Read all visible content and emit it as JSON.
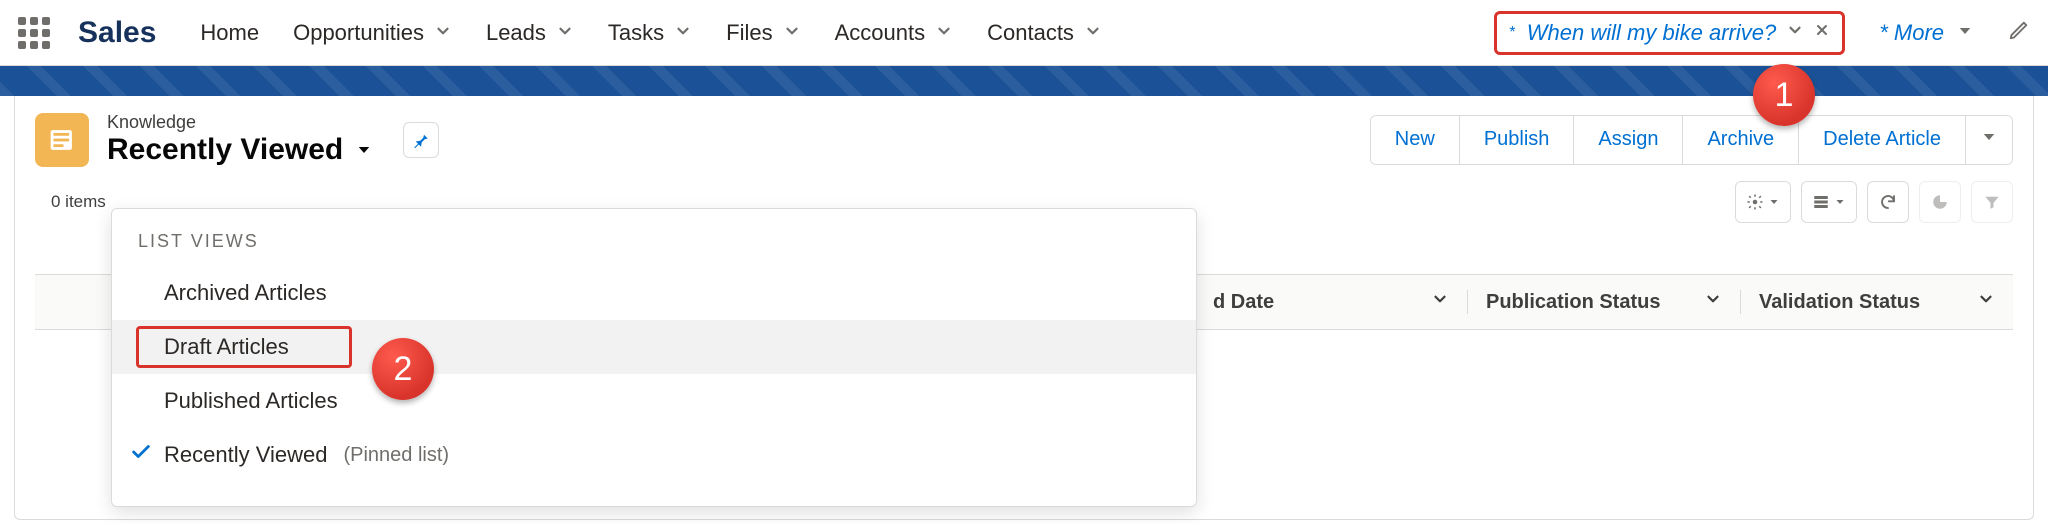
{
  "app": {
    "name": "Sales"
  },
  "nav": {
    "items": [
      {
        "label": "Home",
        "has_menu": false
      },
      {
        "label": "Opportunities",
        "has_menu": true
      },
      {
        "label": "Leads",
        "has_menu": true
      },
      {
        "label": "Tasks",
        "has_menu": true
      },
      {
        "label": "Files",
        "has_menu": true
      },
      {
        "label": "Accounts",
        "has_menu": true
      },
      {
        "label": "Contacts",
        "has_menu": true
      }
    ],
    "active_tab": {
      "label": "When will my bike arrive?",
      "dirty_prefix": "*"
    },
    "more_label": "* More"
  },
  "page": {
    "object_label": "Knowledge",
    "view_name": "Recently Viewed",
    "items_count_label": "0 items"
  },
  "actions": {
    "buttons": [
      "New",
      "Publish",
      "Assign",
      "Archive",
      "Delete Article"
    ]
  },
  "list_views": {
    "heading": "LIST VIEWS",
    "options": [
      {
        "label": "Archived Articles"
      },
      {
        "label": "Draft Articles"
      },
      {
        "label": "Published Articles"
      },
      {
        "label": "Recently Viewed",
        "pinned_note": "(Pinned list)"
      }
    ]
  },
  "columns": [
    {
      "label": "d Date"
    },
    {
      "label": "Publication Status"
    },
    {
      "label": "Validation Status"
    }
  ],
  "badges": {
    "one": "1",
    "two": "2"
  }
}
